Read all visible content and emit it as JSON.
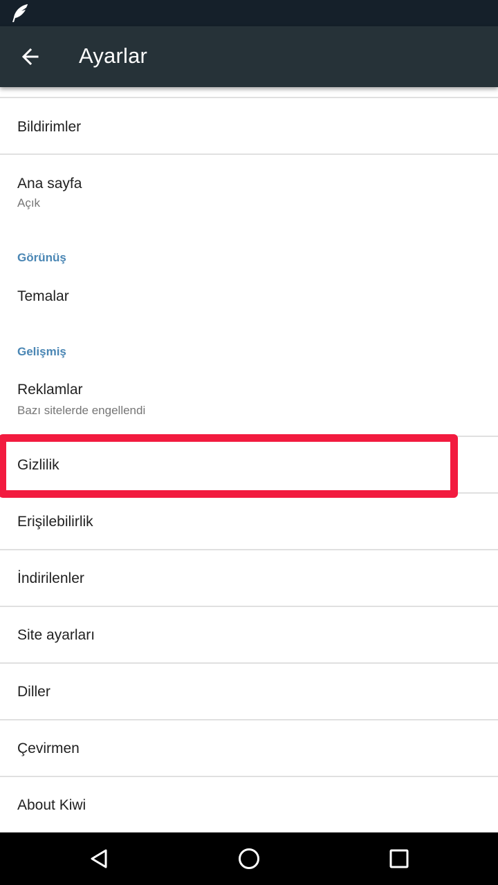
{
  "status_bar": {
    "icon": "feather-icon"
  },
  "app_bar": {
    "title": "Ayarlar",
    "back_icon": "arrow-left-icon"
  },
  "list": {
    "items": [
      {
        "label": "Bildirimler"
      },
      {
        "label": "Ana sayfa",
        "sub": "Açık"
      },
      {
        "section": "Görünüş"
      },
      {
        "label": "Temalar"
      },
      {
        "section": "Gelişmiş"
      },
      {
        "label": "Reklamlar",
        "sub": "Bazı sitelerde engellendi"
      },
      {
        "label": "Gizlilik",
        "highlighted": true
      },
      {
        "label": "Erişilebilirlik"
      },
      {
        "label": "İndirilenler"
      },
      {
        "label": "Site ayarları"
      },
      {
        "label": "Diller"
      },
      {
        "label": "Çevirmen"
      },
      {
        "label": "About Kiwi"
      }
    ]
  },
  "highlight_color": "#f21b3f",
  "accent_color": "#4a86b4",
  "nav_bar": {
    "back_icon": "triangle-back-icon",
    "home_icon": "circle-home-icon",
    "recents_icon": "square-recents-icon"
  }
}
